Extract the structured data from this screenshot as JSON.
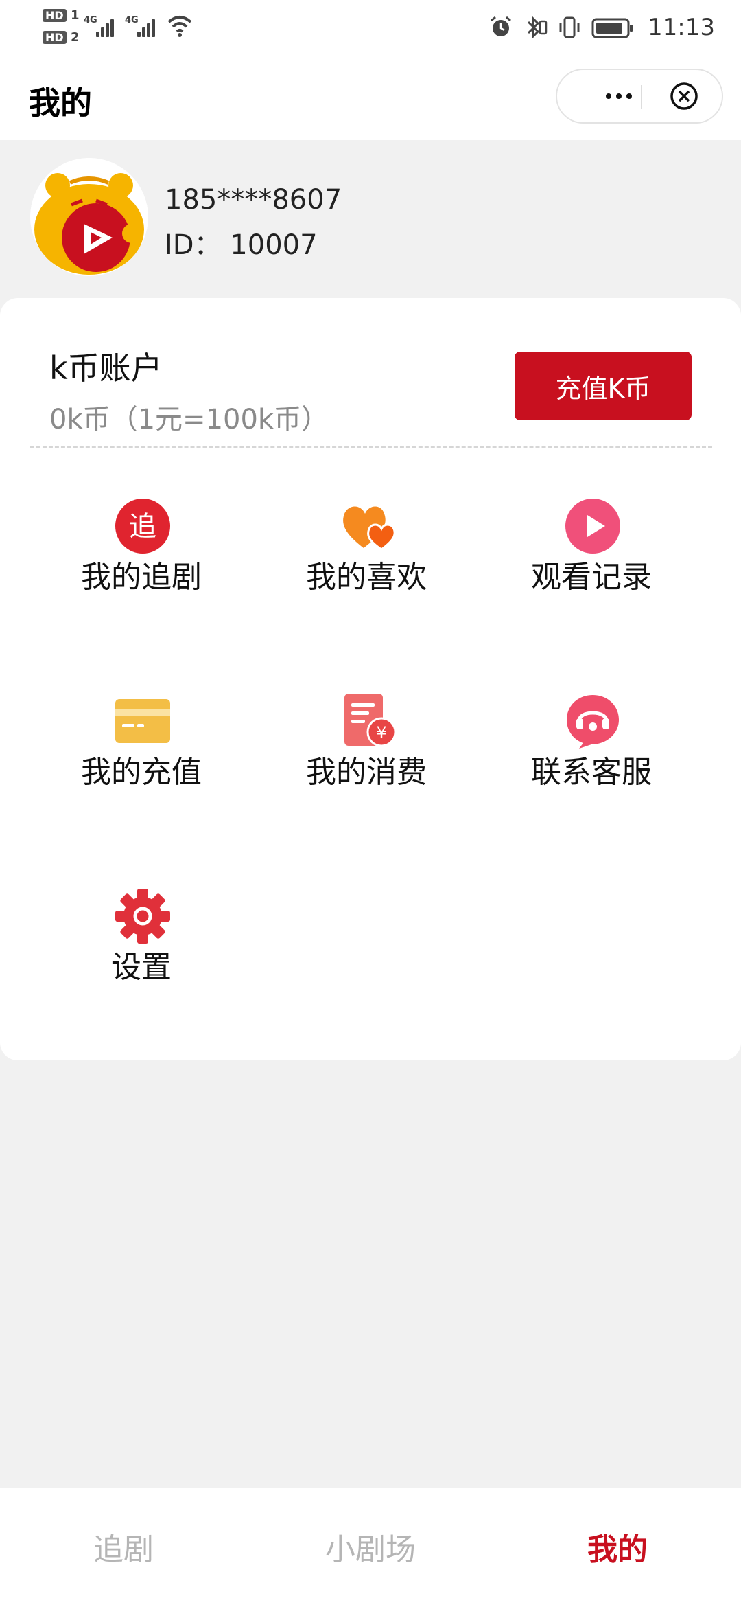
{
  "status_bar": {
    "hd1": "HD",
    "hd1_num": "1",
    "hd2": "HD",
    "hd2_num": "2",
    "net1": "4G",
    "net2": "4G",
    "time": "11:13"
  },
  "header": {
    "title": "我的"
  },
  "profile": {
    "phone": "185****8607",
    "id_text": "ID：  10007"
  },
  "account": {
    "title": "k币账户",
    "balance": "0k币（1元=100k币）",
    "recharge_label": "充值K币"
  },
  "menu": {
    "items": [
      {
        "label": "我的追剧",
        "icon": "follow-badge-icon",
        "glyph": "追"
      },
      {
        "label": "我的喜欢",
        "icon": "hearts-icon"
      },
      {
        "label": "观看记录",
        "icon": "play-circle-icon"
      },
      {
        "label": "我的充值",
        "icon": "card-icon"
      },
      {
        "label": "我的消费",
        "icon": "bill-yuan-icon",
        "glyph": "¥"
      },
      {
        "label": "联系客服",
        "icon": "headset-icon"
      },
      {
        "label": "设置",
        "icon": "gear-icon"
      }
    ]
  },
  "tabbar": {
    "tabs": [
      {
        "label": "追剧",
        "active": false
      },
      {
        "label": "小剧场",
        "active": false
      },
      {
        "label": "我的",
        "active": true
      }
    ]
  },
  "colors": {
    "accent": "#c8101f",
    "tab_inactive": "#b5b5b5",
    "background": "#f1f1f1"
  }
}
